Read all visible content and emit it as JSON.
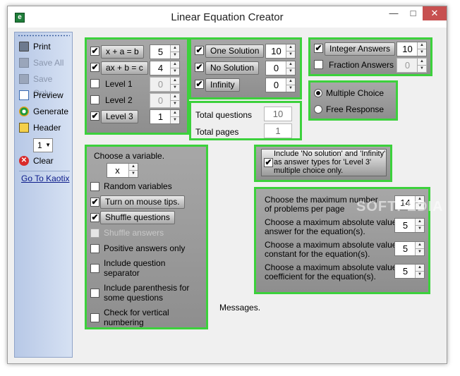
{
  "window": {
    "title": "Linear Equation Creator",
    "controls": {
      "minimize": "—",
      "maximize": "□",
      "close": "✕"
    }
  },
  "toolbar": {
    "items": [
      {
        "label": "Print",
        "icon": "printer-icon",
        "enabled": true
      },
      {
        "label": "Save All",
        "icon": "save-all-icon",
        "enabled": false
      },
      {
        "label": "Save Only",
        "icon": "save-only-icon",
        "enabled": false
      },
      {
        "label": "Preview",
        "icon": "preview-icon",
        "enabled": true
      },
      {
        "label": "Generate",
        "icon": "generate-icon",
        "enabled": true
      },
      {
        "label": "Header",
        "icon": "header-icon",
        "enabled": true
      },
      {
        "label": "Clear",
        "icon": "clear-icon",
        "enabled": true
      }
    ],
    "header_select": "1",
    "link": "Go To Kaotix"
  },
  "levels": [
    {
      "label": "x + a = b",
      "checked": true,
      "value": "5",
      "enabled": true
    },
    {
      "label": "ax + b = c",
      "checked": true,
      "value": "4",
      "enabled": true
    },
    {
      "label": "Level 1",
      "checked": false,
      "value": "0",
      "enabled": false
    },
    {
      "label": "Level 2",
      "checked": false,
      "value": "0",
      "enabled": false
    },
    {
      "label": "Level 3",
      "checked": true,
      "value": "1",
      "enabled": true
    }
  ],
  "solutions": [
    {
      "label": "One Solution",
      "checked": true,
      "value": "10"
    },
    {
      "label": "No Solution",
      "checked": true,
      "value": "0"
    },
    {
      "label": "Infinity",
      "checked": true,
      "value": "0"
    }
  ],
  "answers": [
    {
      "label": "Integer Answers",
      "checked": true,
      "value": "10",
      "enabled": true
    },
    {
      "label": "Fraction Answers",
      "checked": false,
      "value": "0",
      "enabled": false
    }
  ],
  "answer_type": {
    "options": [
      "Multiple Choice",
      "Free Response"
    ],
    "selected": "Multiple Choice"
  },
  "totals": {
    "questions_label": "Total questions",
    "questions_value": "10",
    "pages_label": "Total pages",
    "pages_value": "1"
  },
  "options": {
    "variable_label": "Choose a variable.",
    "variable_value": "x",
    "items": [
      {
        "label": "Random variables",
        "checked": false,
        "enabled": true,
        "button": false
      },
      {
        "label": "Turn on mouse tips.",
        "checked": true,
        "enabled": true,
        "button": true
      },
      {
        "label": "Shuffle questions",
        "checked": true,
        "enabled": true,
        "button": true
      },
      {
        "label": "Shuffle answers",
        "checked": false,
        "enabled": false,
        "button": false
      },
      {
        "label": "Positive answers only",
        "checked": false,
        "enabled": true,
        "button": false
      },
      {
        "label_line1": "Include question",
        "label_line2": "separator",
        "checked": false,
        "enabled": true
      },
      {
        "label_line1": "Include parenthesis for",
        "label_line2": "some questions",
        "checked": false,
        "enabled": true
      },
      {
        "label_line1": "Check for vertical",
        "label_line2": "numbering",
        "checked": false,
        "enabled": true
      }
    ]
  },
  "include_note": {
    "checked": true,
    "line1": "Include 'No solution' and 'Infinity'",
    "line2": "as answer types for 'Level 3'",
    "line3": "multiple choice only."
  },
  "maximums": [
    {
      "line1": "Choose the maximum number",
      "line2": "of problems per page",
      "value": "14"
    },
    {
      "line1": "Choose a  maximum absolute value",
      "line2": "answer for the equation(s).",
      "value": "5"
    },
    {
      "line1": "Choose a  maximum absolute value",
      "line2": "constant for the equation(s).",
      "value": "5"
    },
    {
      "line1": "Choose a  maximum absolute value",
      "line2": "coefficient for the equation(s).",
      "value": "5"
    }
  ],
  "messages_label": "Messages.",
  "watermark": "SOFTPEDIA"
}
